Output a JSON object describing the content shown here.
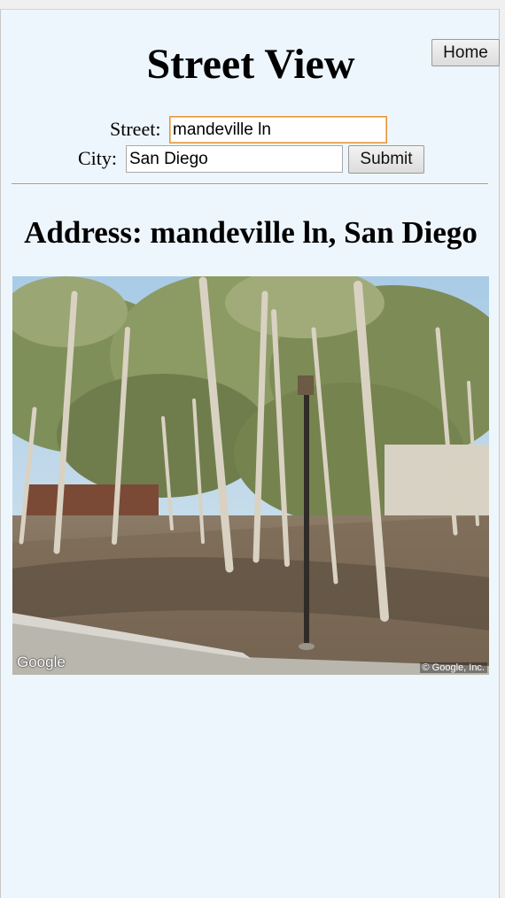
{
  "header": {
    "title": "Street View",
    "home_label": "Home"
  },
  "form": {
    "street_label": "Street:",
    "street_value": "mandeville ln",
    "city_label": "City:",
    "city_value": "San Diego",
    "submit_label": "Submit"
  },
  "result": {
    "address_text": "Address: mandeville ln, San Diego",
    "image_watermark": "Google",
    "image_copyright": "© Google, Inc."
  },
  "colors": {
    "page_background": "#eef6fd",
    "focus_border": "#e0963a"
  }
}
